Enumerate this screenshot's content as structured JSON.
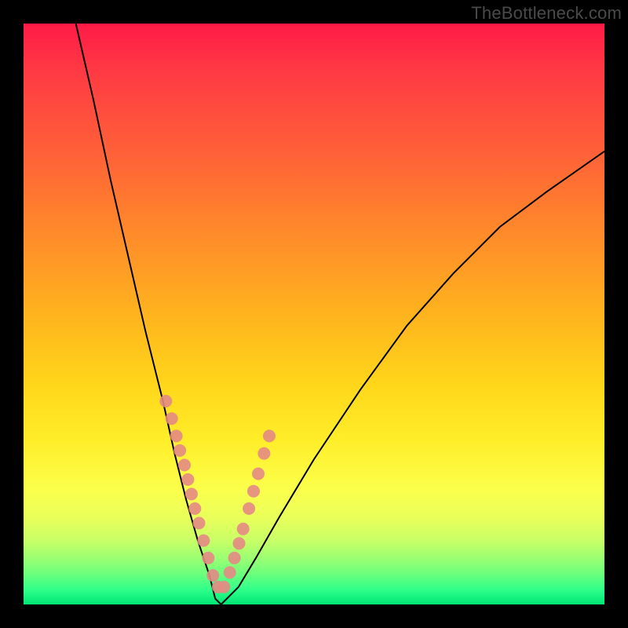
{
  "watermark": "TheBottleneck.com",
  "chart_data": {
    "type": "line",
    "title": "",
    "xlabel": "",
    "ylabel": "",
    "xlim": [
      0,
      100
    ],
    "ylim": [
      0,
      100
    ],
    "description": "Bottleneck V-curve: steep descent from top-left converging with a shallower curve rising to the right; minimum near x≈33 at y≈0. Background vertical gradient red→green encodes bottleneck severity (high at top, optimal at bottom).",
    "series": [
      {
        "name": "left-branch",
        "x": [
          9,
          12,
          15,
          18,
          21,
          24,
          26,
          28,
          30,
          32,
          33,
          34
        ],
        "y": [
          100,
          87,
          73,
          60,
          47,
          35,
          26,
          18,
          11,
          5,
          1,
          0
        ]
      },
      {
        "name": "right-branch",
        "x": [
          34,
          37,
          40,
          44,
          50,
          58,
          66,
          74,
          82,
          90,
          100
        ],
        "y": [
          0,
          3,
          8,
          15,
          25,
          37,
          48,
          57,
          65,
          71,
          78
        ]
      }
    ],
    "markers": {
      "name": "sample-points",
      "x_pct": [
        24.5,
        25.5,
        26.3,
        26.9,
        27.7,
        28.3,
        28.9,
        29.5,
        30.2,
        31.0,
        31.8,
        32.6,
        33.5,
        34.5,
        35.5,
        36.3,
        37.1,
        37.8,
        38.8,
        39.6,
        40.4,
        41.4,
        42.3
      ],
      "y_pct": [
        65.0,
        68.0,
        71.0,
        73.5,
        76.0,
        78.5,
        81.0,
        83.5,
        86.0,
        89.0,
        92.0,
        95.0,
        97.0,
        97.0,
        94.5,
        92.0,
        89.5,
        87.0,
        83.5,
        80.5,
        77.5,
        74.0,
        71.0
      ]
    },
    "gradient_stops": [
      {
        "pct": 0,
        "color": "#ff1a46"
      },
      {
        "pct": 50,
        "color": "#ffd61a"
      },
      {
        "pct": 80,
        "color": "#fbff4a"
      },
      {
        "pct": 100,
        "color": "#00e676"
      }
    ]
  }
}
